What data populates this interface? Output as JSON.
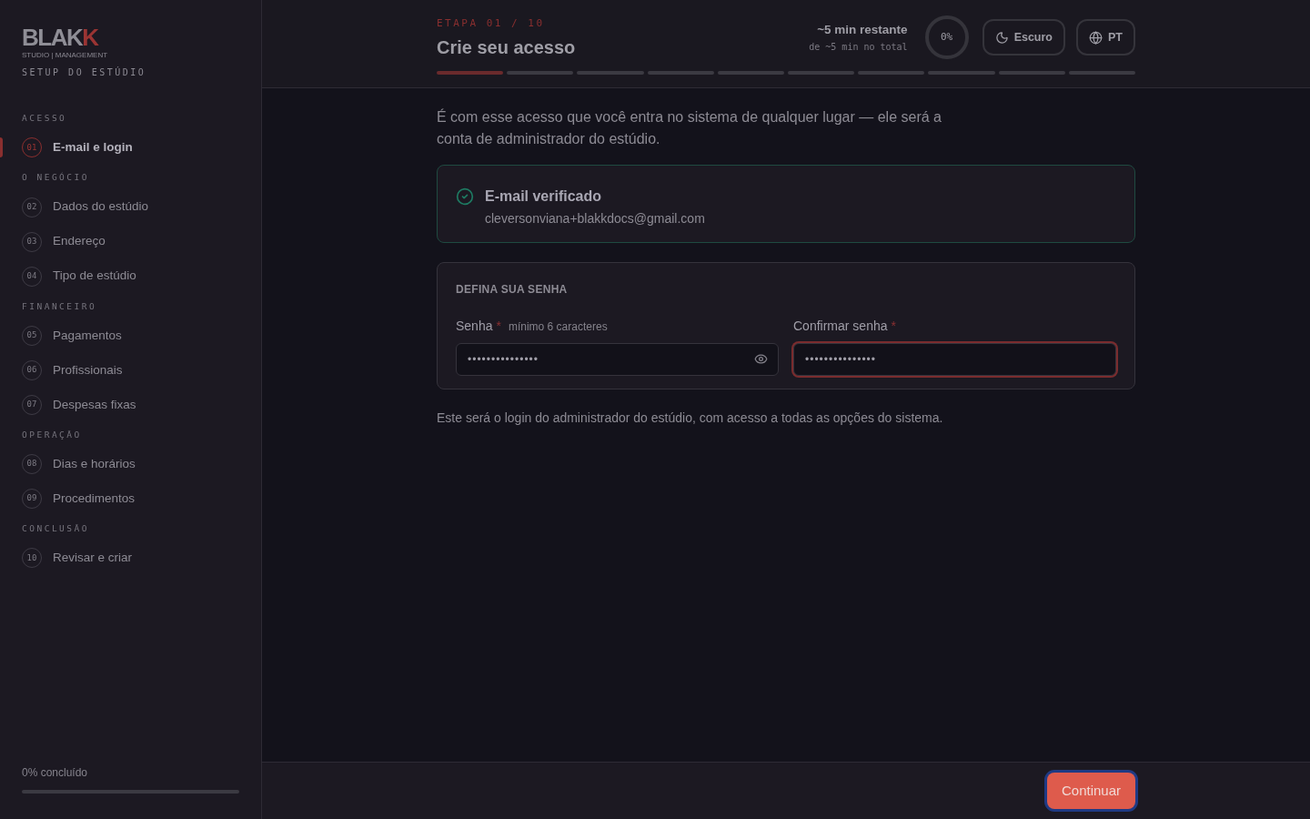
{
  "sidebar": {
    "logo": {
      "main": "BLAK",
      "accent": "K",
      "tagline": "STUDIO | MANAGEMENT"
    },
    "subtitle": "SETUP DO ESTÚDIO",
    "groups": [
      {
        "title": "ACESSO",
        "items": [
          {
            "number": "01",
            "label": "E-mail e login",
            "selected": true
          }
        ]
      },
      {
        "title": "O NEGÓCIO",
        "items": [
          {
            "number": "02",
            "label": "Dados do estúdio",
            "selected": false
          },
          {
            "number": "03",
            "label": "Endereço",
            "selected": false
          },
          {
            "number": "04",
            "label": "Tipo de estúdio",
            "selected": false
          }
        ]
      },
      {
        "title": "FINANCEIRO",
        "items": [
          {
            "number": "05",
            "label": "Pagamentos",
            "selected": false
          },
          {
            "number": "06",
            "label": "Profissionais",
            "selected": false
          },
          {
            "number": "07",
            "label": "Despesas fixas",
            "selected": false
          }
        ]
      },
      {
        "title": "OPERAÇÃO",
        "items": [
          {
            "number": "08",
            "label": "Dias e horários",
            "selected": false
          },
          {
            "number": "09",
            "label": "Procedimentos",
            "selected": false
          }
        ]
      },
      {
        "title": "CONCLUSÃO",
        "items": [
          {
            "number": "10",
            "label": "Revisar e criar",
            "selected": false
          }
        ]
      }
    ],
    "progress": {
      "label": "0% concluído",
      "level": 0
    }
  },
  "header": {
    "step": "ETAPA 01 / 10",
    "title": "Crie seu acesso",
    "time_remaining": "~5 min restante",
    "time_total": "de ~5 min no total",
    "ring": {
      "label": "0%"
    },
    "theme_button": "Escuro",
    "language_button": "PT",
    "segments": [
      {
        "selected": true
      },
      {
        "selected": false
      },
      {
        "selected": false
      },
      {
        "selected": false
      },
      {
        "selected": false
      },
      {
        "selected": false
      },
      {
        "selected": false
      },
      {
        "selected": false
      },
      {
        "selected": false
      },
      {
        "selected": false
      }
    ]
  },
  "intro": "É com esse acesso que você entra no sistema de qualquer lugar — ele será a conta de administrador do estúdio.",
  "verified": {
    "title": "E-mail verificado",
    "email": "cleversonviana+blakkdocs@gmail.com"
  },
  "password_card": {
    "title": "DEFINA SUA SENHA",
    "fields": [
      {
        "label": "Senha",
        "required_mark": "*",
        "hint": "mínimo 6 caracteres",
        "value": "•••••••••••••••",
        "reveal_toggle": true,
        "invalid": false
      },
      {
        "label": "Confirmar senha",
        "required_mark": "*",
        "value": "•••••••••••••••",
        "reveal_toggle": false,
        "invalid": true
      }
    ]
  },
  "note": "Este será o login do administrador do estúdio, com acesso a todas as opções do sistema.",
  "footer": {
    "continue_button": "Continuar"
  }
}
